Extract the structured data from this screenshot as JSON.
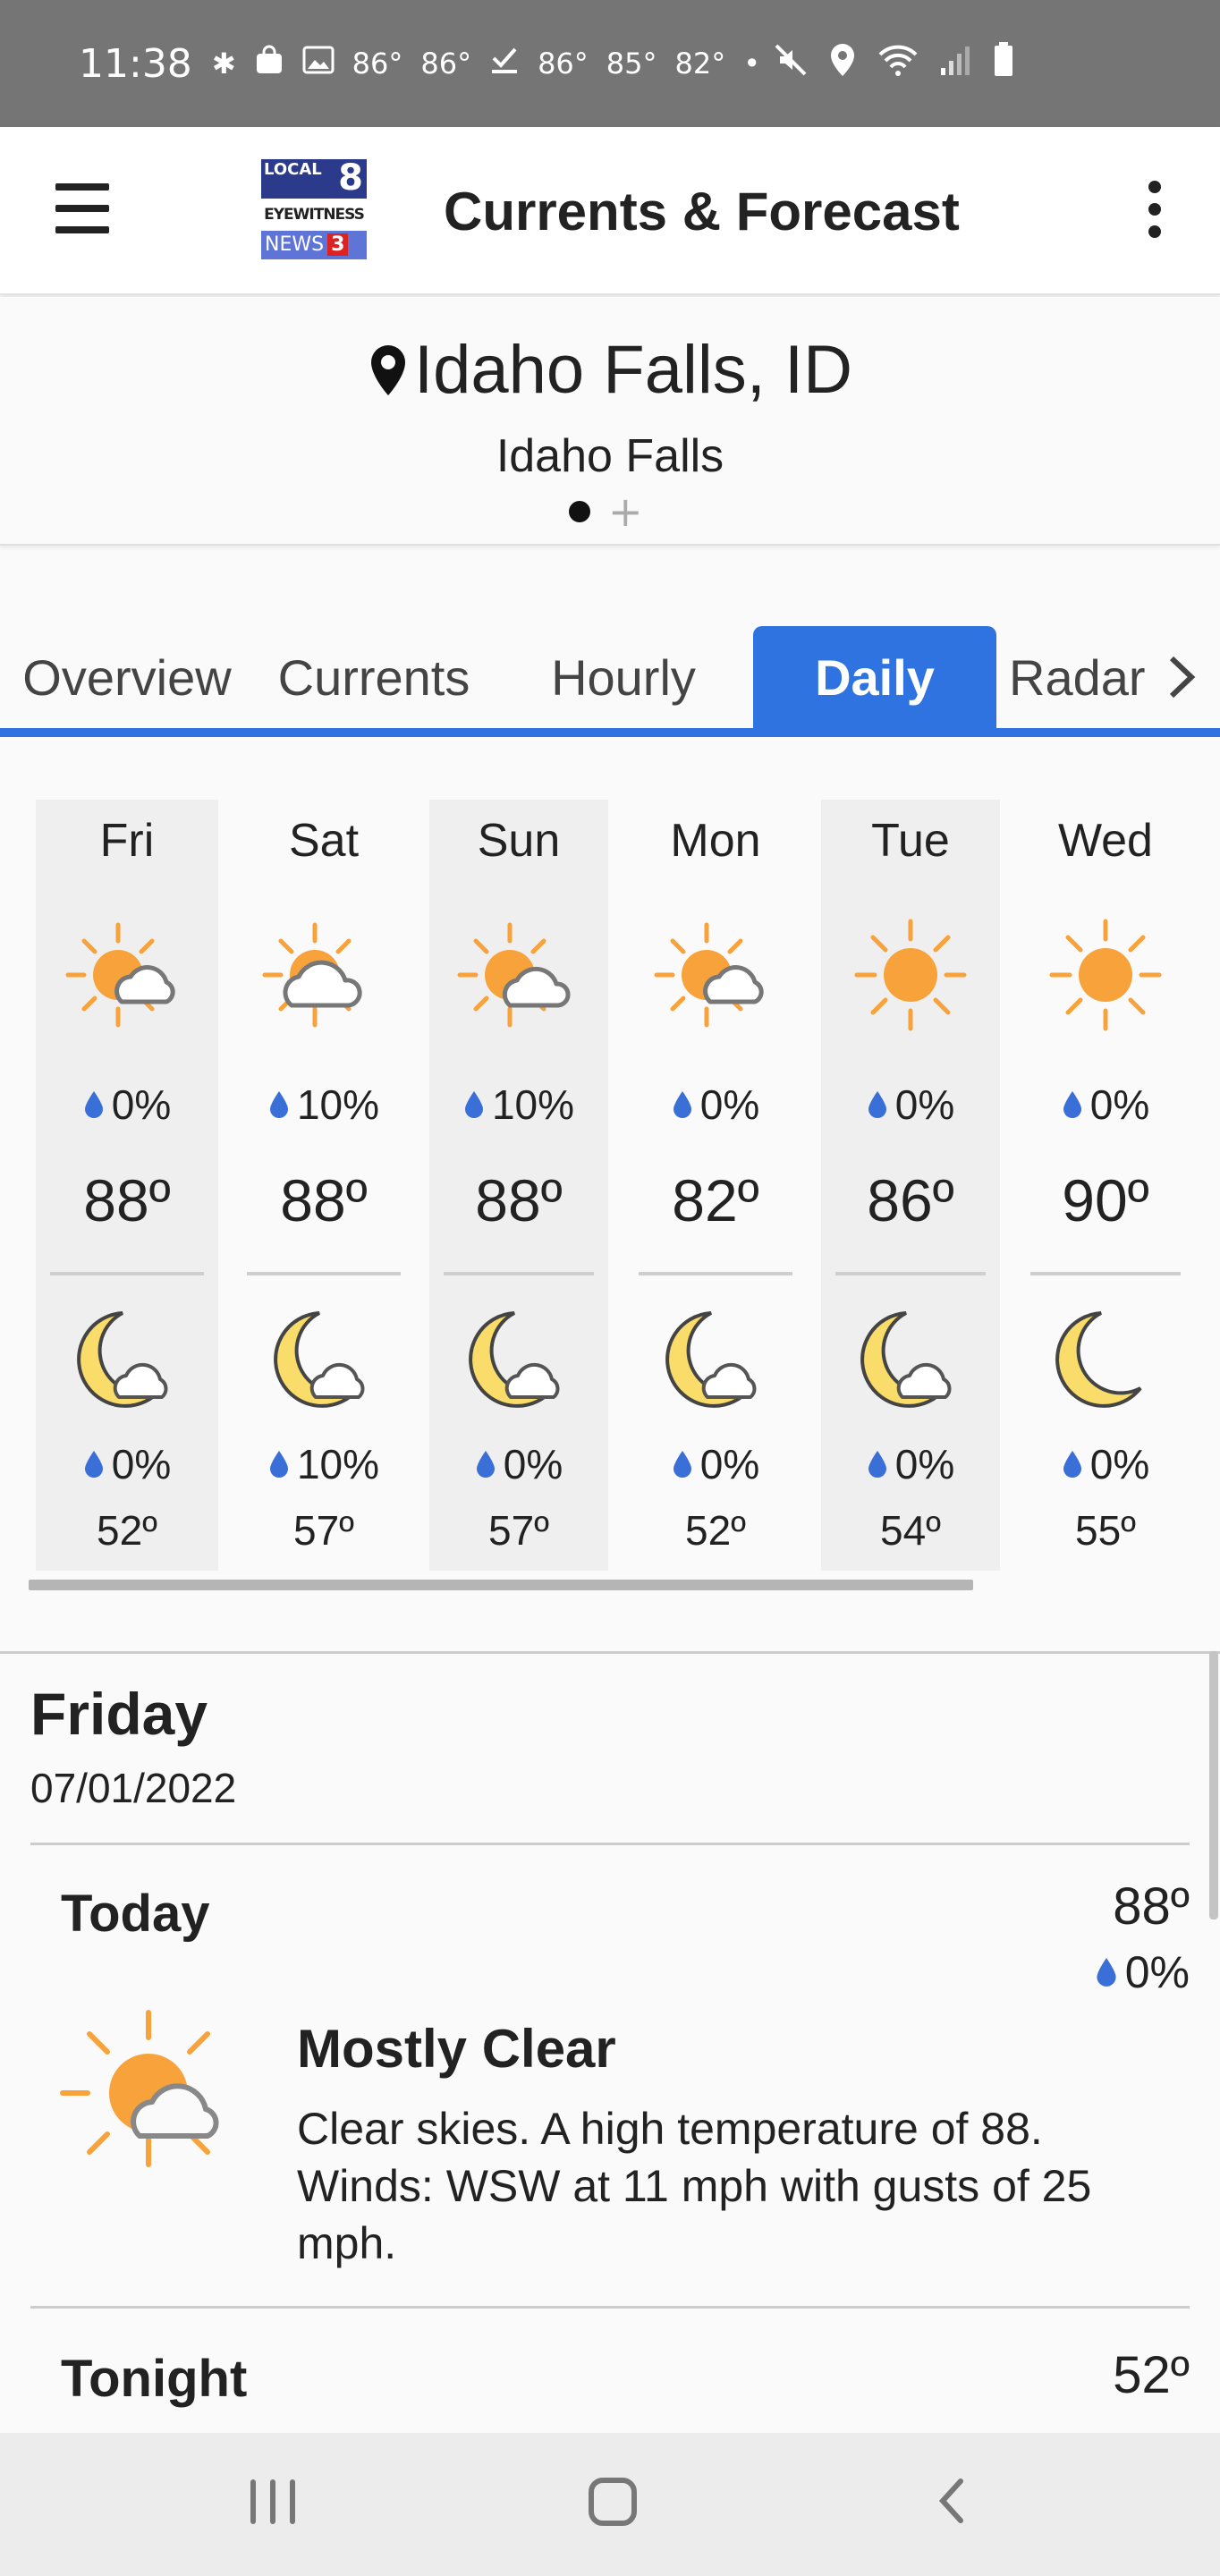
{
  "status_bar": {
    "time": "11:38",
    "temps": [
      "86°",
      "86°",
      "86°",
      "85°",
      "82°"
    ],
    "icons": [
      "slack-icon",
      "bag-icon",
      "image-icon",
      "download-check-icon",
      "dot-icon",
      "mute-icon",
      "location-icon",
      "wifi-icon",
      "signal-icon",
      "battery-icon"
    ]
  },
  "app_bar": {
    "title": "Currents & Forecast",
    "logo": {
      "top": "LOCAL",
      "top_num": "8",
      "mid": "EYEWITNESS",
      "bottom": "NEWS",
      "bottom_num": "3"
    }
  },
  "location": {
    "name": "Idaho Falls, ID",
    "subtitle": "Idaho Falls",
    "page_count": 1
  },
  "tabs": [
    {
      "label": "Overview",
      "active": false
    },
    {
      "label": "Currents",
      "active": false
    },
    {
      "label": "Hourly",
      "active": false
    },
    {
      "label": "Daily",
      "active": true
    },
    {
      "label": "Radar",
      "active": false
    }
  ],
  "daily": [
    {
      "day": "Fri",
      "day_icon": "partly-sunny-icon",
      "day_precip": "0%",
      "high": "88º",
      "night_icon": "moon-cloud-icon",
      "night_precip": "0%",
      "low": "52º"
    },
    {
      "day": "Sat",
      "day_icon": "partly-sunny-icon",
      "day_precip": "10%",
      "high": "88º",
      "night_icon": "moon-cloud-icon",
      "night_precip": "10%",
      "low": "57º"
    },
    {
      "day": "Sun",
      "day_icon": "partly-sunny-icon",
      "day_precip": "10%",
      "high": "88º",
      "night_icon": "moon-cloud-icon",
      "night_precip": "0%",
      "low": "57º"
    },
    {
      "day": "Mon",
      "day_icon": "partly-sunny-icon",
      "day_precip": "0%",
      "high": "82º",
      "night_icon": "moon-cloud-icon",
      "night_precip": "0%",
      "low": "52º"
    },
    {
      "day": "Tue",
      "day_icon": "sun-icon",
      "day_precip": "0%",
      "high": "86º",
      "night_icon": "moon-cloud-icon",
      "night_precip": "0%",
      "low": "54º"
    },
    {
      "day": "Wed",
      "day_icon": "sun-icon",
      "day_precip": "0%",
      "high": "90º",
      "night_icon": "moon-icon",
      "night_precip": "0%",
      "low": "55º"
    }
  ],
  "detail": {
    "day_name": "Friday",
    "date": "07/01/2022",
    "today": {
      "label": "Today",
      "temp": "88º",
      "precip": "0%",
      "condition": "Mostly Clear",
      "description": "Clear skies.  A high temperature of 88. Winds: WSW at 11 mph with gusts of 25 mph."
    },
    "tonight": {
      "label": "Tonight",
      "temp": "52º"
    }
  },
  "colors": {
    "accent": "#2f73e0",
    "sun": "#f7a23a",
    "moon": "#f9dc6a",
    "drop": "#3a6fd8",
    "status_bar": "#757575"
  }
}
